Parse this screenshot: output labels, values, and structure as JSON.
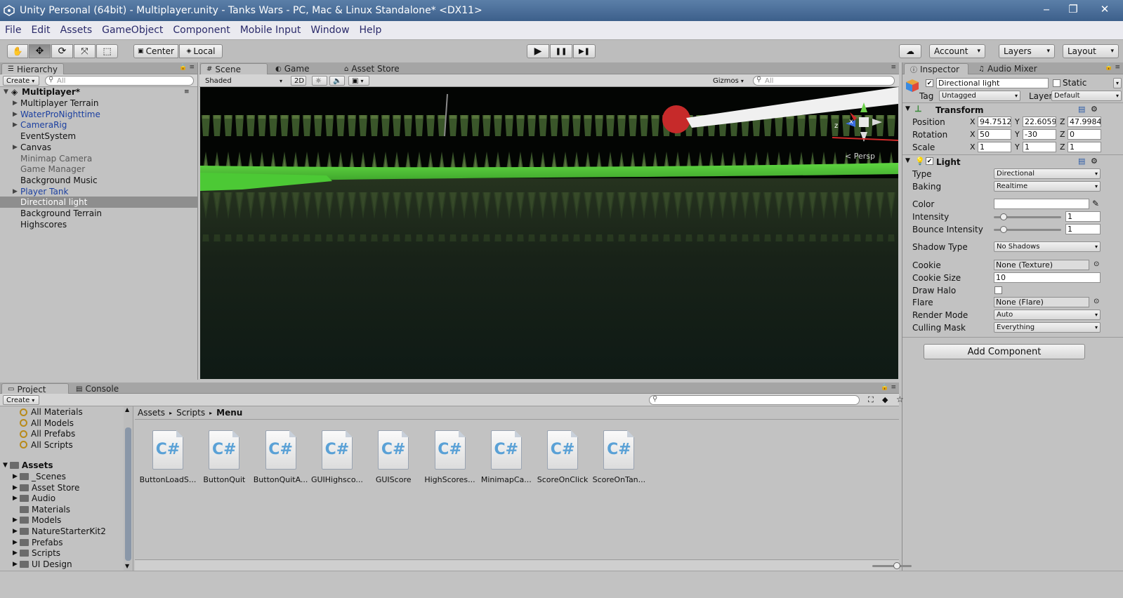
{
  "window": {
    "title": "Unity Personal (64bit) - Multiplayer.unity - Tanks Wars - PC, Mac & Linux Standalone* <DX11>",
    "minimize": "‒",
    "maximize": "❐",
    "close": "✕"
  },
  "menu": [
    "File",
    "Edit",
    "Assets",
    "GameObject",
    "Component",
    "Mobile Input",
    "Window",
    "Help"
  ],
  "toolbar": {
    "tools": [
      "hand-icon",
      "move-icon",
      "rotate-icon",
      "scale-icon",
      "rect-icon"
    ],
    "pivot": "Center",
    "space": "Local",
    "play": "▶",
    "pause": "❚❚",
    "step": "▶❚",
    "account": "Account",
    "layers": "Layers",
    "layout": "Layout"
  },
  "hierarchy": {
    "tab": "Hierarchy",
    "create": "Create",
    "search_placeholder": "All",
    "scene": "Multiplayer*",
    "items": [
      {
        "label": "Multiplayer Terrain",
        "expandable": true,
        "style": "normal",
        "selected": false
      },
      {
        "label": "WaterProNighttime",
        "expandable": true,
        "style": "prefab",
        "selected": false
      },
      {
        "label": "CameraRig",
        "expandable": true,
        "style": "prefab",
        "selected": false
      },
      {
        "label": "EventSystem",
        "expandable": false,
        "style": "normal",
        "selected": false
      },
      {
        "label": "Canvas",
        "expandable": true,
        "style": "normal",
        "selected": false
      },
      {
        "label": "Minimap Camera",
        "expandable": false,
        "style": "inactive",
        "selected": false
      },
      {
        "label": "Game Manager",
        "expandable": false,
        "style": "inactive",
        "selected": false
      },
      {
        "label": "Background Music",
        "expandable": false,
        "style": "normal",
        "selected": false
      },
      {
        "label": "Player Tank",
        "expandable": true,
        "style": "prefab",
        "selected": false
      },
      {
        "label": "Directional light",
        "expandable": false,
        "style": "normal",
        "selected": true
      },
      {
        "label": "Background Terrain",
        "expandable": false,
        "style": "normal",
        "selected": false
      },
      {
        "label": "Highscores",
        "expandable": false,
        "style": "normal",
        "selected": false
      }
    ]
  },
  "scene": {
    "tabs": [
      "Scene",
      "Game",
      "Asset Store"
    ],
    "shading": "Shaded",
    "mode2d": "2D",
    "gizmos": "Gizmos",
    "search_placeholder": "All",
    "persp": "< Persp",
    "axis_x": "x",
    "axis_z": "z"
  },
  "inspector": {
    "tabs": [
      "Inspector",
      "Audio Mixer"
    ],
    "object_name": "Directional light",
    "static_label": "Static",
    "tag_label": "Tag",
    "tag_value": "Untagged",
    "layer_label": "Layer",
    "layer_value": "Default",
    "transform": {
      "title": "Transform",
      "position": {
        "label": "Position",
        "x": "94.7512",
        "y": "22.6059",
        "z": "47.9984"
      },
      "rotation": {
        "label": "Rotation",
        "x": "50",
        "y": "-30",
        "z": "0"
      },
      "scale": {
        "label": "Scale",
        "x": "1",
        "y": "1",
        "z": "1"
      }
    },
    "light": {
      "title": "Light",
      "type_label": "Type",
      "type": "Directional",
      "baking_label": "Baking",
      "baking": "Realtime",
      "color_label": "Color",
      "color": "#ffffff",
      "intensity_label": "Intensity",
      "intensity": "1",
      "bounce_label": "Bounce Intensity",
      "bounce": "1",
      "shadow_label": "Shadow Type",
      "shadow": "No Shadows",
      "cookie_label": "Cookie",
      "cookie": "None (Texture)",
      "cookie_size_label": "Cookie Size",
      "cookie_size": "10",
      "draw_halo_label": "Draw Halo",
      "flare_label": "Flare",
      "flare": "None (Flare)",
      "render_mode_label": "Render Mode",
      "render_mode": "Auto",
      "culling_label": "Culling Mask",
      "culling": "Everything"
    },
    "add_component": "Add Component"
  },
  "project": {
    "tabs": [
      "Project",
      "Console"
    ],
    "create": "Create",
    "favorites": [
      "All Materials",
      "All Models",
      "All Prefabs",
      "All Scripts"
    ],
    "assets_root": "Assets",
    "folders": [
      {
        "label": "_Scenes",
        "expandable": true
      },
      {
        "label": "Asset Store",
        "expandable": true
      },
      {
        "label": "Audio",
        "expandable": true
      },
      {
        "label": "Materials",
        "expandable": false
      },
      {
        "label": "Models",
        "expandable": true
      },
      {
        "label": "NatureStarterKit2",
        "expandable": true
      },
      {
        "label": "Prefabs",
        "expandable": true
      },
      {
        "label": "Scripts",
        "expandable": true
      },
      {
        "label": "UI Design",
        "expandable": true
      }
    ],
    "breadcrumb": [
      "Assets",
      "Scripts",
      "Menu"
    ],
    "files": [
      "ButtonLoadS...",
      "ButtonQuit",
      "ButtonQuitA...",
      "GUIHighsco...",
      "GUIScore",
      "HighScores...",
      "MinimapCa...",
      "ScoreOnClick",
      "ScoreOnTan..."
    ],
    "file_glyph": "C#"
  },
  "colors": {
    "selection": "#8e8e8e",
    "prefab_text": "#1b3fa0",
    "inactive_text": "#5a5a5a"
  }
}
